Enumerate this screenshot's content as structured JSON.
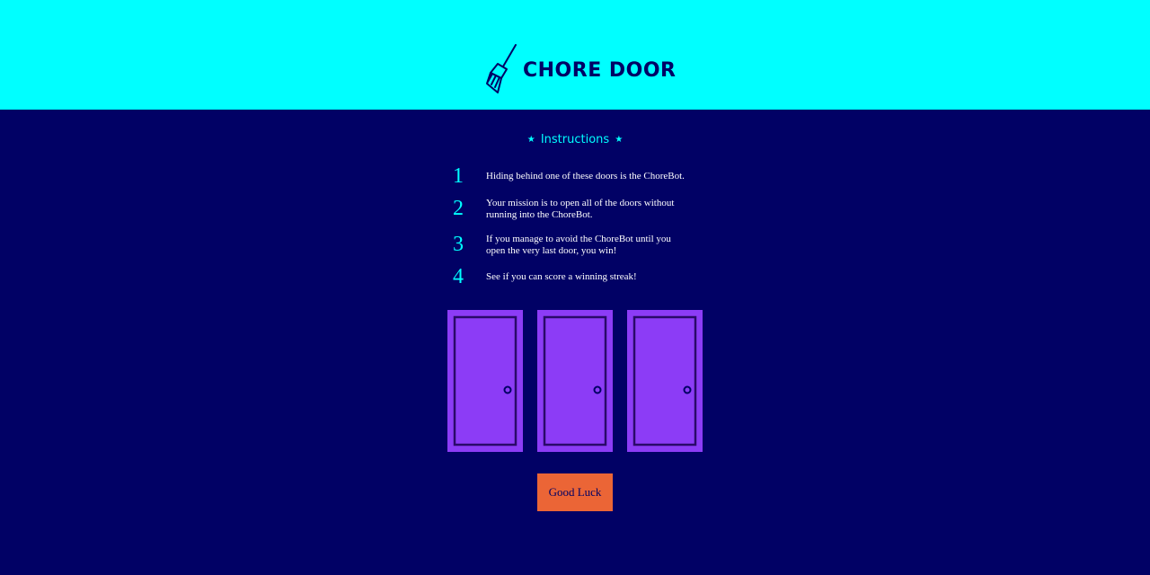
{
  "header": {
    "title": "CHORE DOOR",
    "logo_icon": "broom-icon"
  },
  "instructions": {
    "title": "Instructions",
    "star": "★",
    "steps": [
      {
        "number": "1",
        "text": "Hiding behind one of these doors is the ChoreBot."
      },
      {
        "number": "2",
        "text": "Your mission is to open all of the doors without running into the ChoreBot."
      },
      {
        "number": "3",
        "text": "If you manage to avoid the ChoreBot until you open the very last door, you win!"
      },
      {
        "number": "4",
        "text": "See if you can score a winning streak!"
      }
    ]
  },
  "doors": [
    {
      "label": "door-1",
      "state": "closed"
    },
    {
      "label": "door-2",
      "state": "closed"
    },
    {
      "label": "door-3",
      "state": "closed"
    }
  ],
  "start_button": {
    "label": "Good Luck"
  },
  "colors": {
    "header_bg": "#00ffff",
    "body_bg": "#010165",
    "accent": "#00ffff",
    "door_fill": "#8c3cf6",
    "button_bg": "#eb6536"
  }
}
